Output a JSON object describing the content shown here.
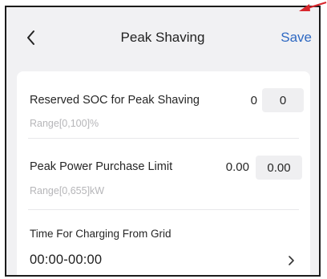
{
  "header": {
    "title": "Peak Shaving",
    "save_label": "Save"
  },
  "settings": [
    {
      "label": "Reserved SOC for Peak Shaving",
      "current_value": "0",
      "input_value": "0",
      "range_hint": "Range[0,100]%"
    },
    {
      "label": "Peak Power Purchase Limit",
      "current_value": "0.00",
      "input_value": "0.00",
      "range_hint": "Range[0,655]kW"
    }
  ],
  "charging_time": {
    "label": "Time For Charging From Grid",
    "value": "00:00-00:00"
  },
  "colors": {
    "accent": "#2f69c2",
    "annotation_arrow": "#d8262c",
    "background": "#f1f1f3",
    "card": "#ffffff"
  },
  "icons": {
    "back": "chevron-left-icon",
    "navigate": "chevron-right-icon",
    "annotation": "arrow-icon"
  }
}
